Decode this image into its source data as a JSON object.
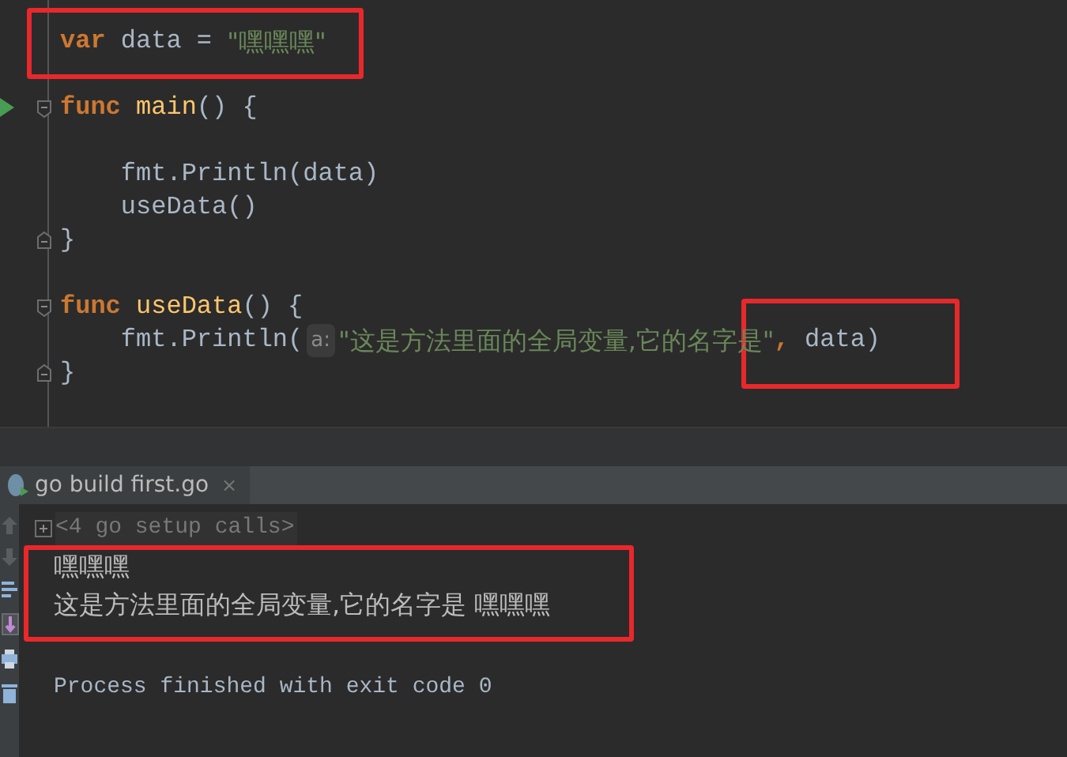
{
  "editor": {
    "lines": [
      {
        "kind": "plain",
        "tokens": [
          {
            "kind": "keyword",
            "text": "var "
          },
          {
            "kind": "plain",
            "text": "data = "
          },
          {
            "kind": "string",
            "text": "\"嘿嘿嘿\""
          }
        ]
      },
      {
        "kind": "plain"
      },
      {
        "kind": "opener",
        "run": true,
        "tokens": [
          {
            "kind": "keyword",
            "text": "func "
          },
          {
            "kind": "func",
            "text": "main"
          },
          {
            "kind": "plain",
            "text": "() {"
          }
        ]
      },
      {
        "kind": "plain"
      },
      {
        "kind": "plain",
        "tokens": [
          {
            "kind": "plain",
            "text": "    fmt.Println(data)"
          }
        ]
      },
      {
        "kind": "plain",
        "tokens": [
          {
            "kind": "plain",
            "text": "    useData()"
          }
        ]
      },
      {
        "kind": "closer",
        "tokens": [
          {
            "kind": "plain",
            "text": "}"
          }
        ]
      },
      {
        "kind": "plain"
      },
      {
        "kind": "opener",
        "tokens": [
          {
            "kind": "keyword",
            "text": "func "
          },
          {
            "kind": "func",
            "text": "useData"
          },
          {
            "kind": "plain",
            "text": "() {"
          }
        ]
      },
      {
        "kind": "plain",
        "tokens": [
          {
            "kind": "plain",
            "text": "    fmt.Println("
          },
          {
            "kind": "hint",
            "text": "a:"
          },
          {
            "kind": "string",
            "text": "\"这是方法里面的全局变量,它的名字是\""
          },
          {
            "kind": "keyword",
            "text": ","
          },
          {
            "kind": "plain",
            "text": " data)"
          }
        ]
      },
      {
        "kind": "closer",
        "tokens": [
          {
            "kind": "plain",
            "text": "}"
          }
        ]
      }
    ]
  },
  "run_panel": {
    "tab": {
      "label": "go build first.go",
      "close": "×"
    },
    "folded": {
      "label": "<4 go setup calls>"
    },
    "output": [
      {
        "kind": "stdout",
        "text": "嘿嘿嘿"
      },
      {
        "kind": "stdout",
        "text": "这是方法里面的全局变量,它的名字是 嘿嘿嘿"
      },
      {
        "kind": "exit",
        "text": "Process finished with exit code 0"
      }
    ]
  }
}
